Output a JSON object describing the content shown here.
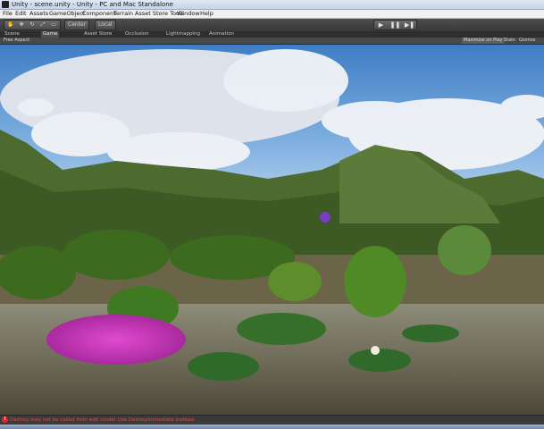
{
  "window": {
    "title": "Unity - scene.unity - Unity - PC and Mac Standalone"
  },
  "menubar": {
    "items": [
      "File",
      "Edit",
      "Assets",
      "GameObject",
      "Component",
      "Terrain",
      "Asset Store Tools",
      "Window",
      "Help"
    ]
  },
  "toolbar": {
    "pivot_label": "Center",
    "space_label": "Local",
    "play_icon": "play-icon",
    "pause_icon": "pause-icon",
    "step_icon": "step-icon"
  },
  "tabs": {
    "items": [
      "Scene",
      "Game",
      "Asset Store",
      "Occlusion",
      "Lightmapping",
      "Animation"
    ],
    "active": "Game"
  },
  "game_bar": {
    "aspect": "Free Aspect",
    "maximize": "Maximize on Play",
    "stats": "Stats",
    "gizmos": "Gizmos"
  },
  "status": {
    "error_icon": "error-icon",
    "message": "Destroy may not be called from edit mode! Use DestroyImmediate instead."
  },
  "colors": {
    "error": "#d8524a",
    "editor_dark": "#3a3a3a",
    "sky_top": "#4f8fd0"
  }
}
